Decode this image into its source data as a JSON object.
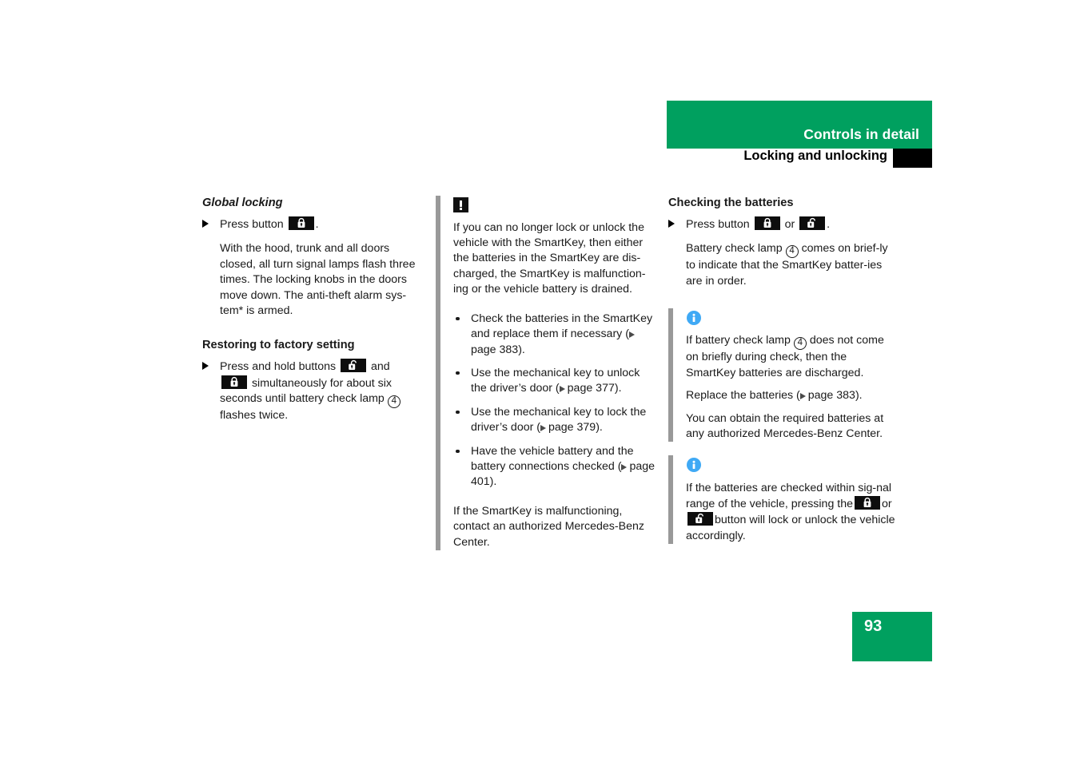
{
  "header": {
    "title": "Controls in detail",
    "subtitle": "Locking and unlocking"
  },
  "page_number": "93",
  "columns": {
    "left": {
      "heading_global": "Global locking",
      "step_press_button_prefix": "Press button",
      "step_press_button_suffix": ".",
      "global_body": "With the hood, trunk and all doors closed, all turn signal lamps flash three times. The locking knobs in the doors move down. The anti-theft alarm sys-tem* is armed.",
      "heading_restoring": "Restoring to factory setting",
      "restore_prefix": "Press and hold buttons",
      "restore_mid": "and",
      "restore_body_1": "simultaneously for about six seconds until battery check lamp",
      "restore_lamp_num": "4",
      "restore_body_2": "flashes twice."
    },
    "middle": {
      "warning_body": "If you can no longer lock or unlock the vehicle with the SmartKey, then either the batteries in the SmartKey are dis-charged, the SmartKey is malfunction-ing or the vehicle battery is drained.",
      "bullets": [
        {
          "text_before": "Check the batteries in the SmartKey and replace them if necessary (",
          "page": "page 383",
          "text_after": ")."
        },
        {
          "text_before": "Use the mechanical key to unlock the driver’s door (",
          "page": "page 377",
          "text_after": ")."
        },
        {
          "text_before": "Use the mechanical key to lock the driver’s door (",
          "page": "page 379",
          "text_after": ")."
        },
        {
          "text_before": "Have the vehicle battery and the battery connections checked (",
          "page": "page 401",
          "text_after": ")."
        }
      ],
      "closing": "If the SmartKey is malfunctioning, contact an authorized Mercedes-Benz Center."
    },
    "right": {
      "heading_checking": "Checking the batteries",
      "step_prefix": "Press button",
      "step_mid": "or",
      "step_suffix": ".",
      "lamp_para_1": "Battery check lamp",
      "lamp_num": "4",
      "lamp_para_2": "comes on brief-ly to indicate that the SmartKey batter-ies are in order.",
      "note1_part1": "If battery check lamp",
      "note1_lamp_num": "4",
      "note1_part2": "does not come on briefly during check, then the SmartKey batteries are discharged.",
      "note1_replace_before": "Replace the batteries (",
      "note1_replace_page": "page 383",
      "note1_replace_after": ").",
      "note1_obtain": "You can obtain the required batteries at any authorized Mercedes-Benz Center.",
      "note2_part1": "If the batteries are checked within sig-nal range of the vehicle, pressing the",
      "note2_or": "or",
      "note2_part2": "button will lock or unlock the vehicle accordingly."
    }
  },
  "icons": {
    "lock": "lock-closed-icon",
    "unlock": "lock-open-icon",
    "warning": "warning-exclamation-icon",
    "info": "info-circle-icon",
    "page_ref": "page-reference-triangle-icon"
  },
  "colors": {
    "brand_green": "#00a05f",
    "info_blue": "#3fa9f5",
    "rule_gray": "#999999",
    "black": "#000000"
  }
}
